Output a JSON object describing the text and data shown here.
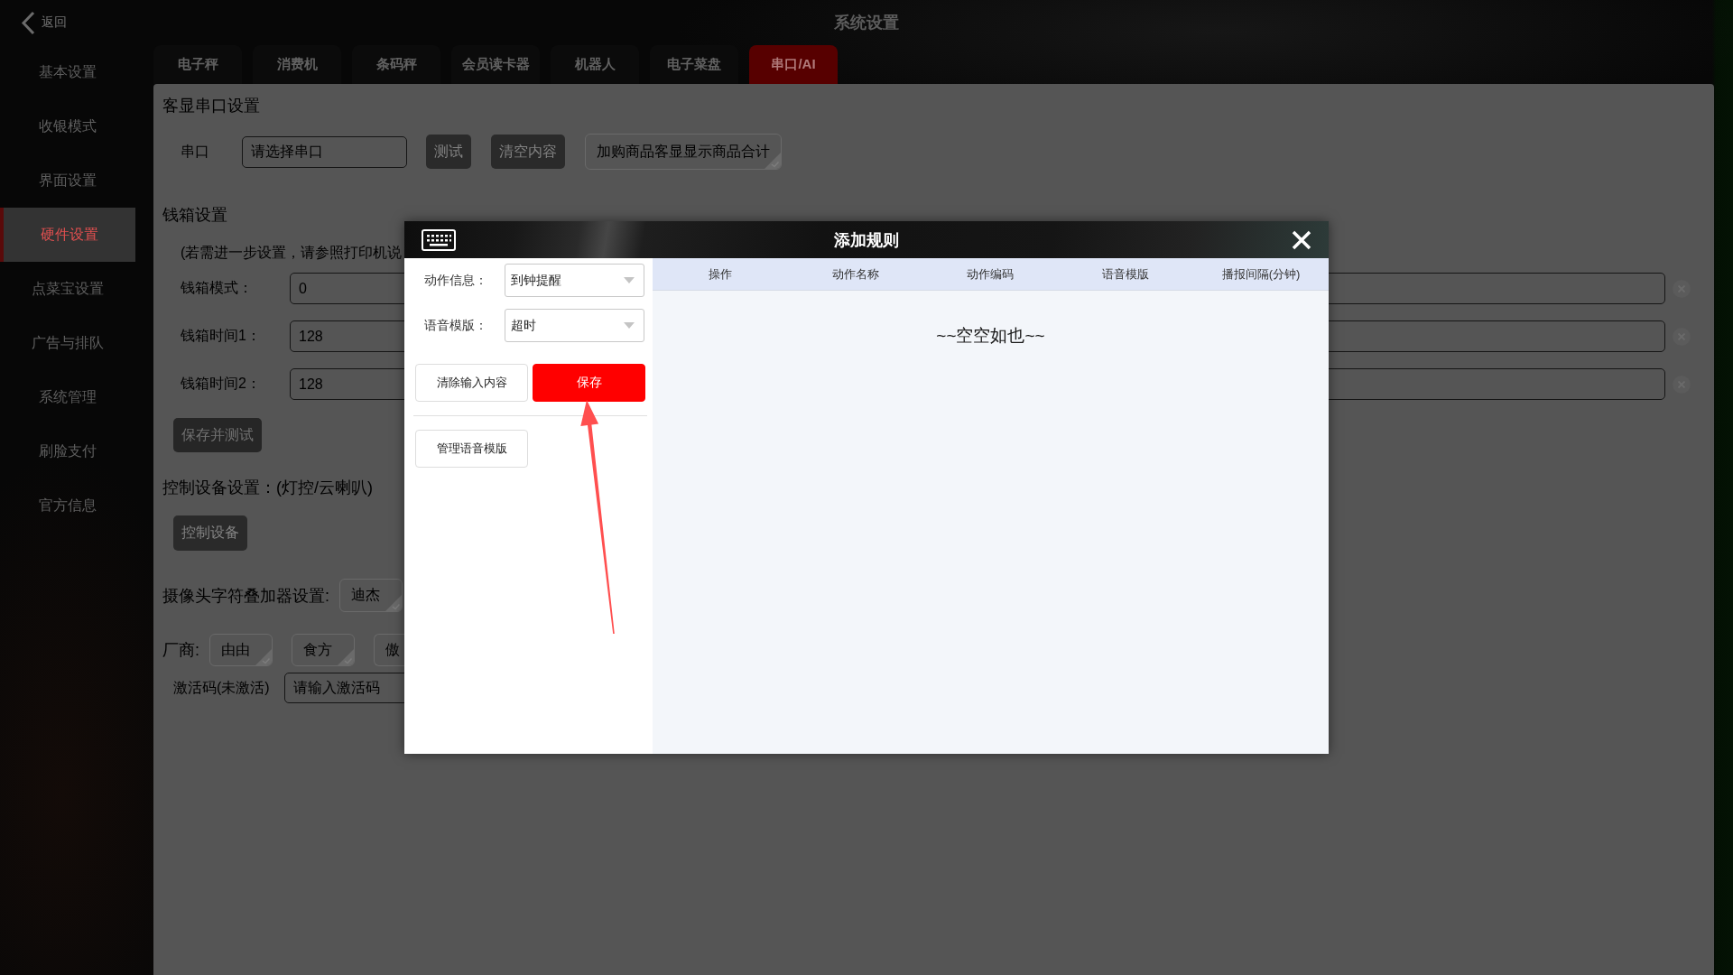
{
  "top_bar": {
    "back": "返回",
    "title": "系统设置"
  },
  "sidebar": {
    "items": [
      {
        "label": "基本设置",
        "selected": false
      },
      {
        "label": "收银模式",
        "selected": false
      },
      {
        "label": "界面设置",
        "selected": false
      },
      {
        "label": "硬件设置",
        "selected": true
      },
      {
        "label": "点菜宝设置",
        "selected": false
      },
      {
        "label": "广告与排队",
        "selected": false
      },
      {
        "label": "系统管理",
        "selected": false
      },
      {
        "label": "刷脸支付",
        "selected": false
      },
      {
        "label": "官方信息",
        "selected": false
      }
    ]
  },
  "tabs": [
    {
      "label": "电子秤",
      "selected": false
    },
    {
      "label": "消费机",
      "selected": false
    },
    {
      "label": "条码秤",
      "selected": false
    },
    {
      "label": "会员读卡器",
      "selected": false
    },
    {
      "label": "机器人",
      "selected": false
    },
    {
      "label": "电子菜盘",
      "selected": false
    },
    {
      "label": "串口/AI",
      "selected": true
    }
  ],
  "customer_display": {
    "heading": "客显串口设置",
    "port": {
      "label": "串口",
      "placeholder": "请选择串口"
    },
    "buttons": [
      "测试",
      "清空内容"
    ],
    "options": [
      {
        "label": "加购商品客显显示商品合计",
        "selected": false
      }
    ]
  },
  "cash_drawer": {
    "heading": "钱箱设置",
    "note": "(若需进一步设置，请参照打印机说",
    "fields": [
      {
        "label": "钱箱模式：",
        "value": "0"
      },
      {
        "label": "钱箱时间1：",
        "value": "128"
      },
      {
        "label": "钱箱时间2：",
        "value": "128"
      }
    ],
    "button": "保存并测试"
  },
  "control_devices": {
    "heading": "控制设备设置：(灯控/云喇叭)",
    "button": "控制设备"
  },
  "camera_overlay": {
    "label": "摄像头字符叠加器设置:",
    "options": [
      {
        "label": "迪杰",
        "selected": false
      }
    ]
  },
  "vendor": {
    "label": "厂商:",
    "options": [
      {
        "label": "由由",
        "selected": false
      },
      {
        "label": "食方",
        "selected": false
      },
      {
        "label": "傲",
        "selected": false
      }
    ]
  },
  "activation": {
    "label": "激活码(未激活)",
    "placeholder": "请输入激活码"
  },
  "dialog": {
    "title": "添加规则",
    "fields": [
      {
        "label": "动作信息：",
        "value": "到钟提醒"
      },
      {
        "label": "语音模版：",
        "value": "超时"
      }
    ],
    "buttons": [
      {
        "label": "清除输入内容",
        "kind": "plain"
      },
      {
        "label": "保存",
        "kind": "primary"
      }
    ],
    "manage_button": "管理语音模版",
    "table": {
      "columns": [
        "操作",
        "动作名称",
        "动作编码",
        "语音模版",
        "播报间隔(分钟)"
      ],
      "empty_text": "~~空空如也~~"
    }
  }
}
